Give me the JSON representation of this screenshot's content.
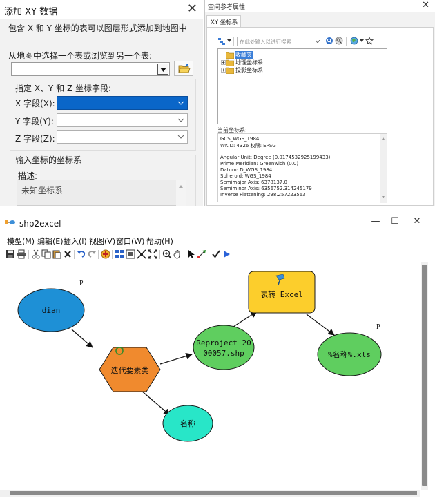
{
  "add_xy": {
    "title": "添加 XY 数据",
    "description": "包含 X 和 Y 坐标的表可以图层形式添加到地图中",
    "choose_table_label": "从地图中选择一个表或浏览到另一个表:",
    "table_value": "",
    "fields_group_label": "指定 X、Y 和 Z 坐标字段:",
    "x_label": "X 字段(X):",
    "y_label": "Y 字段(Y):",
    "z_label": "Z 字段(Z):",
    "x_value": "",
    "y_value": "",
    "z_value": "",
    "crs_group_label": "输入坐标的坐标系",
    "desc_label": "描述:",
    "desc_value": "未知坐标系"
  },
  "spatial_ref": {
    "title": "空间参考属性",
    "tab": "XY 坐标系",
    "search_placeholder": "在此处输入以进行搜索",
    "tree": [
      "收藏夹",
      "地理坐标系",
      "投影坐标系"
    ],
    "current_label": "当前坐标系:",
    "details": [
      "GCS_WGS_1984",
      "WKID: 4326 权限: EPSG",
      "",
      "Angular Unit: Degree (0.0174532925199433)",
      "Prime Meridian: Greenwich (0.0)",
      "Datum: D_WGS_1984",
      "  Spheroid: WGS_1984",
      "    Semimajor Axis: 6378137.0",
      "    Semiminor Axis: 6356752.314245179",
      "    Inverse Flattening: 298.257223563"
    ]
  },
  "model": {
    "title": "shp2excel",
    "menus": [
      "模型(M)",
      "编辑(E)",
      "插入(I)",
      "视图(V)",
      "窗口(W)",
      "帮助(H)"
    ],
    "nodes": {
      "dian": "dian",
      "iterate": "迭代要素类",
      "name": "名称",
      "reproject_1": "Reproject_20",
      "reproject_2": "00057.shp",
      "to_excel": "表转 Excel",
      "output": "%名称%.xls"
    },
    "p_marker": "P",
    "colors": {
      "dian": "#1e90d6",
      "iterate": "#f08a2e",
      "name": "#28e6c8",
      "derived": "#5fce5f",
      "tool": "#fcce2c"
    }
  }
}
